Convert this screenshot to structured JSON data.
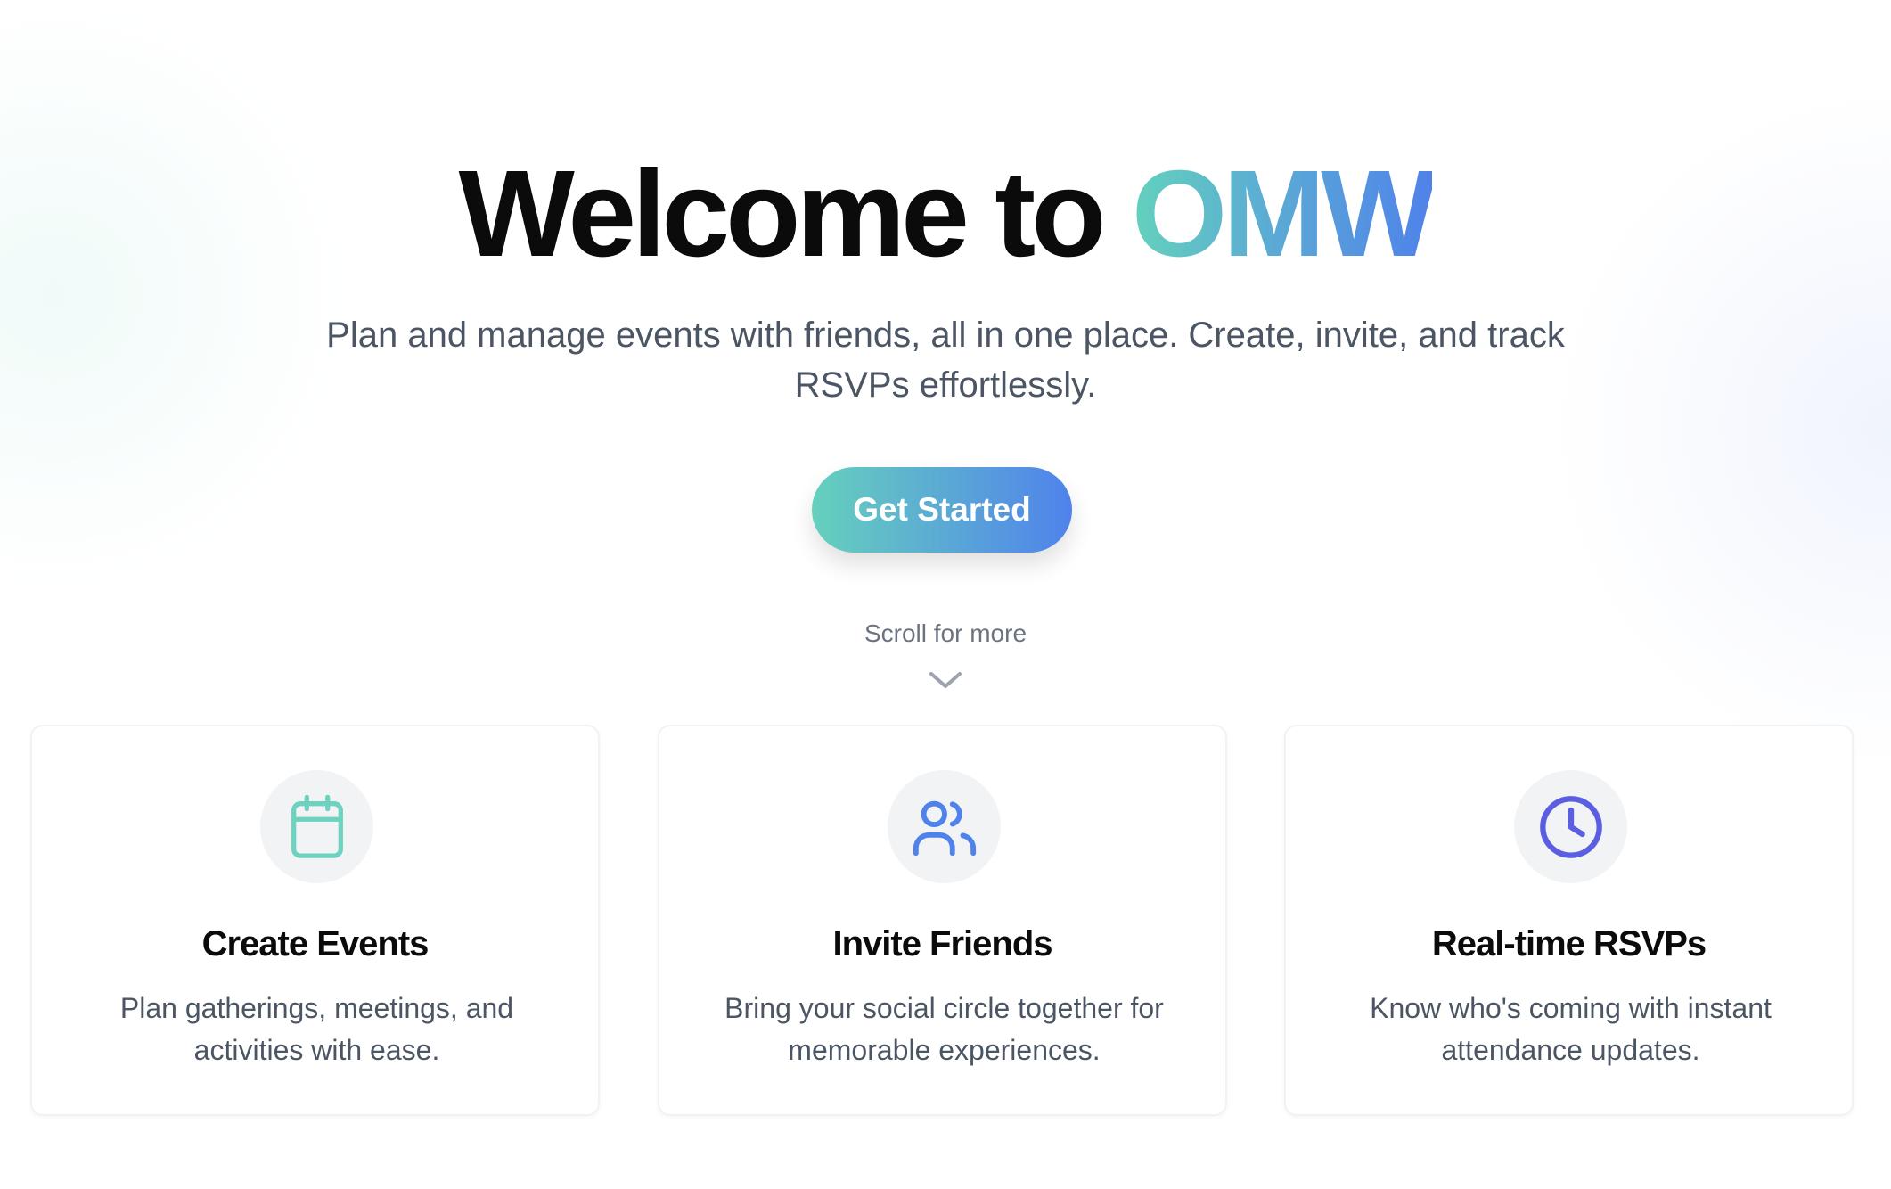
{
  "hero": {
    "title_prefix": "Welcome to ",
    "title_brand": "OMW",
    "subtitle": "Plan and manage events with friends, all in one place. Create, invite, and track RSVPs effortlessly.",
    "cta_label": "Get Started",
    "scroll_hint": "Scroll for more"
  },
  "features": [
    {
      "icon": "calendar-icon",
      "title": "Create Events",
      "description": "Plan gatherings, meetings, and activities with ease.",
      "color": "#6dd3c0"
    },
    {
      "icon": "users-icon",
      "title": "Invite Friends",
      "description": "Bring your social circle together for memorable experiences.",
      "color": "#4f82ea"
    },
    {
      "icon": "clock-icon",
      "title": "Real-time RSVPs",
      "description": "Know who's coming with instant attendance updates.",
      "color": "#5b5ee0"
    }
  ],
  "colors": {
    "brand_start": "#64d1bd",
    "brand_end": "#4f82ea"
  }
}
